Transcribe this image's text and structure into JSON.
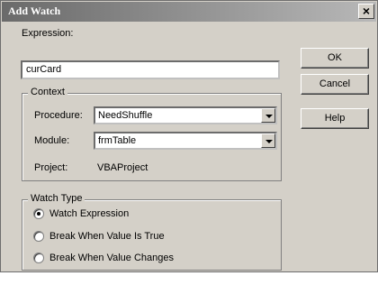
{
  "window": {
    "title": "Add Watch",
    "close_glyph": "×"
  },
  "expression": {
    "label": "Expression:",
    "value": "curCard"
  },
  "buttons": {
    "ok": "OK",
    "cancel": "Cancel",
    "help": "Help"
  },
  "context": {
    "legend": "Context",
    "procedure_label": "Procedure:",
    "procedure_value": "NeedShuffle",
    "module_label": "Module:",
    "module_value": "frmTable",
    "project_label": "Project:",
    "project_value": "VBAProject"
  },
  "watch_type": {
    "legend": "Watch Type",
    "options": [
      {
        "label": "Watch Expression",
        "checked": true
      },
      {
        "label": "Break When Value Is True",
        "checked": false
      },
      {
        "label": "Break When Value Changes",
        "checked": false
      }
    ]
  }
}
